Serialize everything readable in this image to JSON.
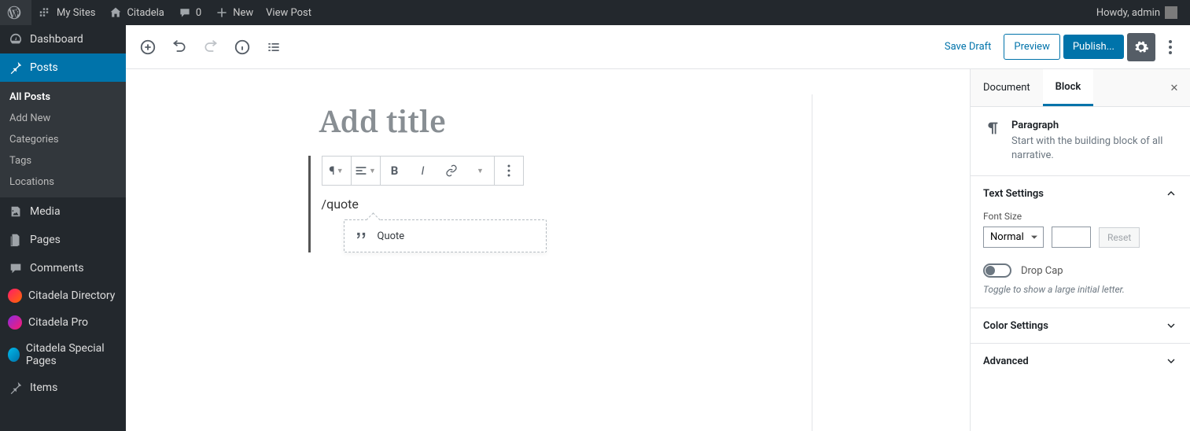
{
  "adminbar": {
    "mysites": "My Sites",
    "site": "Citadela",
    "comments": "0",
    "new": "New",
    "viewpost": "View Post",
    "howdy": "Howdy, admin"
  },
  "sidebar": {
    "dashboard": "Dashboard",
    "posts": "Posts",
    "sub": {
      "all": "All Posts",
      "add": "Add New",
      "cat": "Categories",
      "tags": "Tags",
      "loc": "Locations"
    },
    "media": "Media",
    "pages": "Pages",
    "comments": "Comments",
    "cdir": "Citadela Directory",
    "cpro": "Citadela Pro",
    "cspec": "Citadela Special Pages",
    "items": "Items"
  },
  "editor": {
    "saveDraft": "Save Draft",
    "preview": "Preview",
    "publish": "Publish...",
    "titlePlaceholder": "Add title",
    "content": "/quote",
    "autocomplete": "Quote"
  },
  "panel": {
    "tabDocument": "Document",
    "tabBlock": "Block",
    "blockName": "Paragraph",
    "blockDesc": "Start with the building block of all narrative.",
    "textSettings": "Text Settings",
    "fontSizeLabel": "Font Size",
    "fontSizeValue": "Normal",
    "reset": "Reset",
    "dropCap": "Drop Cap",
    "dropCapHint": "Toggle to show a large initial letter.",
    "colorSettings": "Color Settings",
    "advanced": "Advanced"
  }
}
